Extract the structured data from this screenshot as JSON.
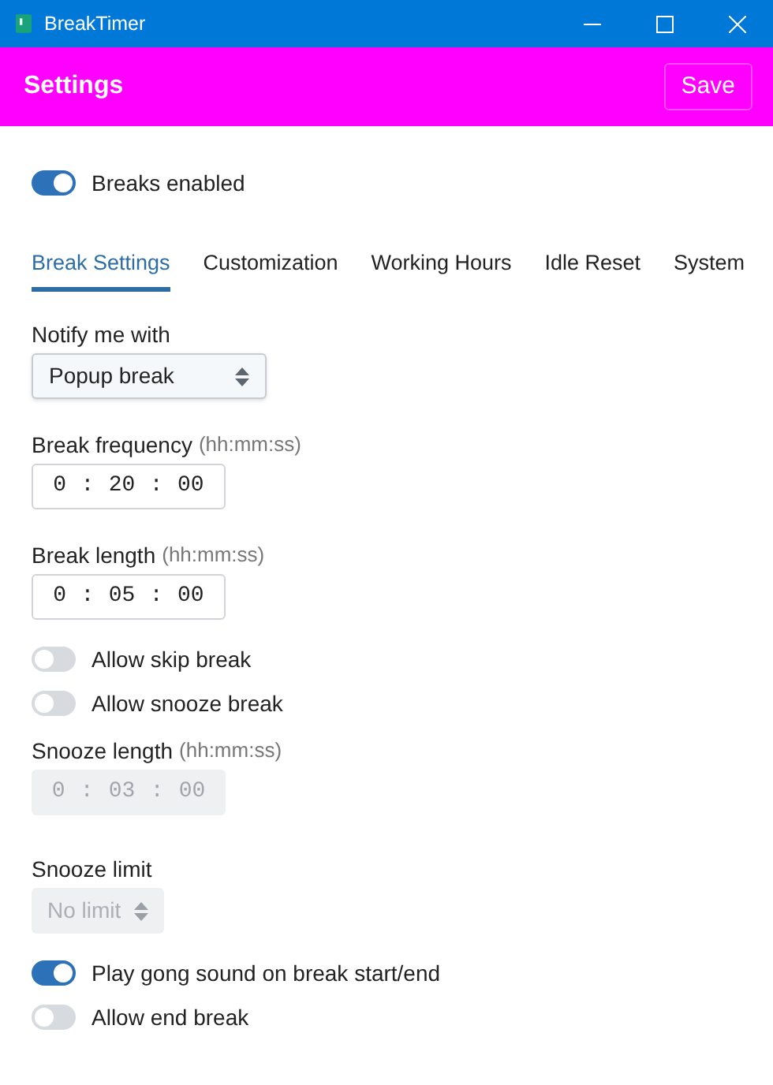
{
  "window": {
    "title": "BreakTimer"
  },
  "header": {
    "title": "Settings",
    "save_button": "Save"
  },
  "master_switch": {
    "label": "Breaks enabled",
    "on": true
  },
  "tabs": [
    {
      "label": "Break Settings",
      "selected": true
    },
    {
      "label": "Customization",
      "selected": false
    },
    {
      "label": "Working Hours",
      "selected": false
    },
    {
      "label": "Idle Reset",
      "selected": false
    },
    {
      "label": "System",
      "selected": false
    }
  ],
  "fields": [
    {
      "kind": "select",
      "label": "Notify me with",
      "value": "Popup break",
      "disabled": false
    },
    {
      "kind": "time",
      "label": "Break frequency",
      "hint": "(hh:mm:ss)",
      "parts": [
        "0",
        ":",
        "20",
        ":",
        "00"
      ],
      "disabled": false
    },
    {
      "kind": "time",
      "label": "Break length",
      "hint": "(hh:mm:ss)",
      "parts": [
        "0",
        ":",
        "05",
        ":",
        "00"
      ],
      "disabled": false
    },
    {
      "kind": "switch",
      "label": "Allow skip break",
      "on": false
    },
    {
      "kind": "switch",
      "label": "Allow snooze break",
      "on": false
    },
    {
      "kind": "time",
      "label": "Snooze length",
      "hint": "(hh:mm:ss)",
      "parts": [
        "0",
        ":",
        "03",
        ":",
        "00"
      ],
      "disabled": true
    },
    {
      "kind": "select",
      "label": "Snooze limit",
      "value": "No limit",
      "disabled": true
    },
    {
      "kind": "switch",
      "label": "Play gong sound on break start/end",
      "on": true
    },
    {
      "kind": "switch",
      "label": "Allow end break",
      "on": false
    }
  ]
}
